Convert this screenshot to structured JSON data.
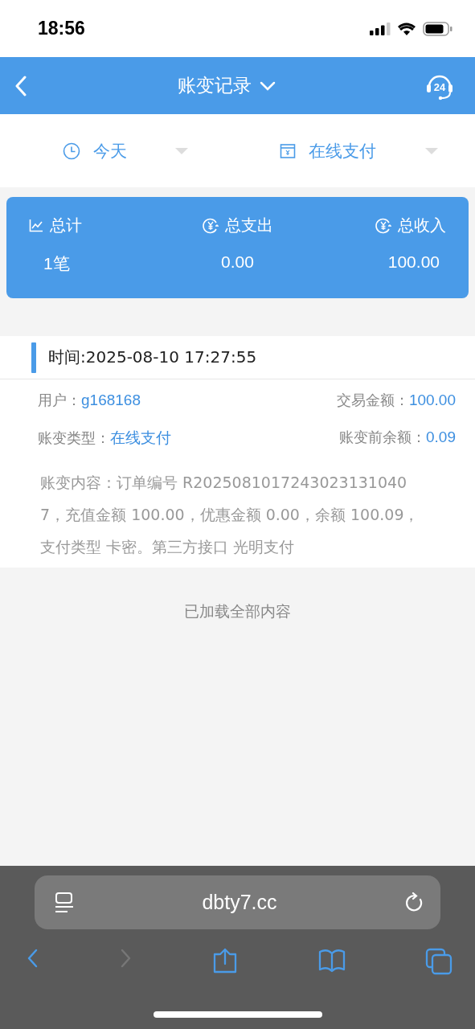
{
  "status_bar": {
    "time": "18:56"
  },
  "header": {
    "title": "账变记录",
    "support_badge": "24"
  },
  "filters": [
    {
      "kind": "date",
      "label": "今天"
    },
    {
      "kind": "channel",
      "label": "在线支付"
    }
  ],
  "summary": [
    {
      "kind": "chart",
      "label": "总计",
      "value": "1笔"
    },
    {
      "kind": "currency",
      "label": "总支出",
      "value": "0.00"
    },
    {
      "kind": "currency",
      "label": "总收入",
      "value": "100.00"
    }
  ],
  "records": [
    {
      "time": "时间:2025-08-10 17:27:55",
      "fields": [
        {
          "label": "用户：",
          "value": "g168168"
        },
        {
          "label": "交易金额：",
          "value": "100.00"
        },
        {
          "label": "账变类型：",
          "value": "在线支付"
        },
        {
          "label": "账变前余额：",
          "value": "0.09"
        }
      ],
      "content": "账变内容：订单编号 R20250810172430231310407，充值金额 100.00，优惠金额 0.00，余额 100.09，支付类型 卡密。第三方接口 光明支付"
    }
  ],
  "end_message": "已加载全部内容",
  "browser": {
    "url": "dbty7.cc",
    "toolbar": [
      {
        "kind": "back",
        "disabled": false
      },
      {
        "kind": "forward",
        "disabled": true
      },
      {
        "kind": "share",
        "disabled": false
      },
      {
        "kind": "bookmarks",
        "disabled": false
      },
      {
        "kind": "tabs",
        "disabled": false
      }
    ]
  }
}
